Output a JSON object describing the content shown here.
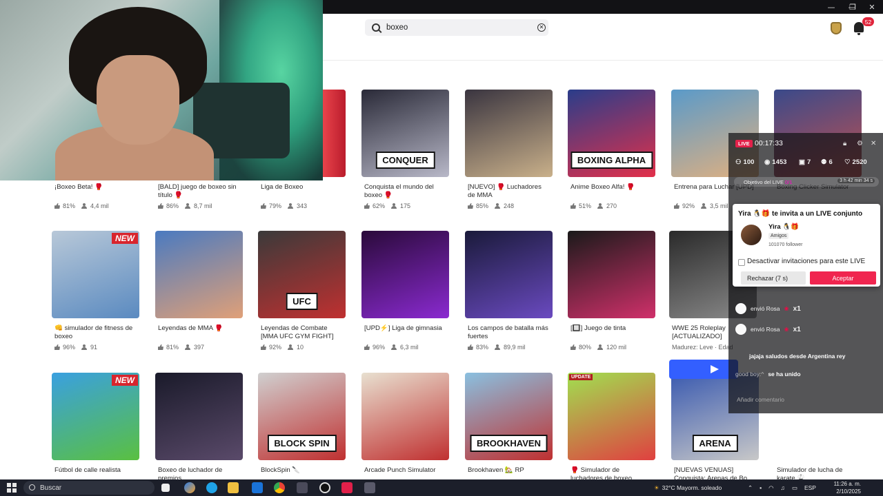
{
  "window": {
    "minimize": "—",
    "maximize": "❐",
    "close": "✕"
  },
  "header": {
    "search_value": "boxeo",
    "notification_count": "52"
  },
  "grid": {
    "row1": [
      {
        "title": "¡Boxeo Beta! 🥊",
        "rating": "81%",
        "players": "4,4 mil",
        "colors": [
          "#3a3f6b",
          "#c94242"
        ]
      },
      {
        "title": "[BALD] juego de boxeo sin título 🥊",
        "rating": "86%",
        "players": "8,7 mil",
        "colors": [
          "#6b5a4a",
          "#d9b08c"
        ]
      },
      {
        "title": "Liga de Boxeo",
        "rating": "79%",
        "players": "343",
        "colors": [
          "#7a3030",
          "#d9a27a"
        ]
      },
      {
        "title": "Conquista el mundo del boxeo 🥊",
        "rating": "62%",
        "players": "175",
        "colors": [
          "#2a2a38",
          "#b8b8c8"
        ],
        "tag": "CONQUER"
      },
      {
        "title": "[NUEVO] 🥊 Luchadores de MMA",
        "rating": "85%",
        "players": "248",
        "colors": [
          "#3a3540",
          "#c9b08a"
        ]
      },
      {
        "title": "Anime Boxeo Alfa! 🥊",
        "rating": "51%",
        "players": "270",
        "colors": [
          "#2a3d8a",
          "#e2304a"
        ],
        "tag": "BOXING ALPHA"
      },
      {
        "title": "Entrena para Luchar [UPD]",
        "rating": "92%",
        "players": "3,5 mil",
        "colors": [
          "#5a9ac9",
          "#e0b080"
        ]
      },
      {
        "title": "Boxing Clicker Simulator",
        "rating": "",
        "players": "",
        "colors": [
          "#3a4a8a",
          "#c05050"
        ]
      }
    ],
    "row2": [
      {
        "title": "👊 simulador de fitness de boxeo",
        "rating": "96%",
        "players": "91",
        "colors": [
          "#b8c8d8",
          "#5a8ac0"
        ],
        "ribbon": "NEW"
      },
      {
        "title": "Leyendas de MMA 🥊",
        "rating": "81%",
        "players": "397",
        "colors": [
          "#4a7ac0",
          "#e0a078"
        ]
      },
      {
        "title": "Leyendas de Combate [MMA UFC GYM FIGHT]",
        "rating": "92%",
        "players": "10",
        "colors": [
          "#3a3a3a",
          "#c03030"
        ],
        "tag": "UFC"
      },
      {
        "title": "[UPD⚡] Liga de gimnasia",
        "rating": "96%",
        "players": "6,3 mil",
        "colors": [
          "#2a0a3a",
          "#8a2ad0"
        ]
      },
      {
        "title": "Los campos de batalla más fuertes",
        "rating": "83%",
        "players": "89,9 mil",
        "colors": [
          "#1a1a3a",
          "#6a4ac0"
        ]
      },
      {
        "title": "[🔲] Juego de tinta",
        "rating": "80%",
        "players": "120 mil",
        "colors": [
          "#1a1a1a",
          "#d0306a"
        ]
      },
      {
        "title": "WWE 25 Roleplay [ACTUALIZADO]",
        "rating": "",
        "players": "",
        "sub": "Madurez: Leve · Edad",
        "colors": [
          "#2a2a2a",
          "#8a8a8a"
        ]
      }
    ],
    "row3": [
      {
        "title": "Fútbol de calle realista",
        "colors": [
          "#3aa0e0",
          "#5ac040"
        ],
        "ribbon": "NEW"
      },
      {
        "title": "Boxeo de luchador de premios",
        "colors": [
          "#1a1a2a",
          "#5a4a6a"
        ]
      },
      {
        "title": "BlockSpin 🔪",
        "colors": [
          "#d0d0d0",
          "#c03030"
        ],
        "tag": "BLOCK SPIN"
      },
      {
        "title": "Arcade Punch Simulator",
        "colors": [
          "#e8e0d0",
          "#c03030"
        ]
      },
      {
        "title": "Brookhaven 🏡 RP",
        "colors": [
          "#8ac0e0",
          "#c03030"
        ],
        "tag": "BROOKHAVEN"
      },
      {
        "title": "🥊 Simulador de luchadores de boxeo",
        "colors": [
          "#a0e050",
          "#e04040"
        ],
        "upd": "UPDATE"
      },
      {
        "title": "[NUEVAS VENUAS] Conquista: Arenas de Bo",
        "colors": [
          "#3a5ab0",
          "#c8c8c8"
        ],
        "tag": "ARENA"
      },
      {
        "title": "Simulador de lucha de karate 🥋",
        "colors": [
          "#ffffff",
          "#ffffff"
        ]
      }
    ]
  },
  "live": {
    "badge": "LIVE",
    "timer": "00:17:33",
    "stats": [
      "100",
      "1453",
      "7",
      "6",
      "2520"
    ],
    "goal_label": "Objetivo del LIVE",
    "goal_progress": "0/1",
    "goal_time": "3 h 42 min 34 s",
    "invite": {
      "title": "Yira 🐧🎁 te invita a un LIVE conjunto",
      "name": "Yira 🐧🎁",
      "tag": "Amigos",
      "followers": "101070 follower",
      "checkbox": "Desactivar invitaciones para este LIVE",
      "reject": "Rechazar (7 s)",
      "accept": "Aceptar"
    },
    "chat": [
      {
        "user": "envió Rosa",
        "gift": "x1"
      },
      {
        "user": "envió Rosa",
        "gift": "x1"
      },
      {
        "user": "",
        "text": "jajaja saludos desde Argentina rey"
      },
      {
        "user": "good boy:^",
        "text": "se ha unido"
      }
    ],
    "comment_placeholder": "Añadir comentario"
  },
  "taskbar": {
    "search": "Buscar",
    "weather": "32°C Mayorm. soleado",
    "lang": "ESP",
    "time": "11:26 a. m.",
    "date": "2/10/2025"
  }
}
